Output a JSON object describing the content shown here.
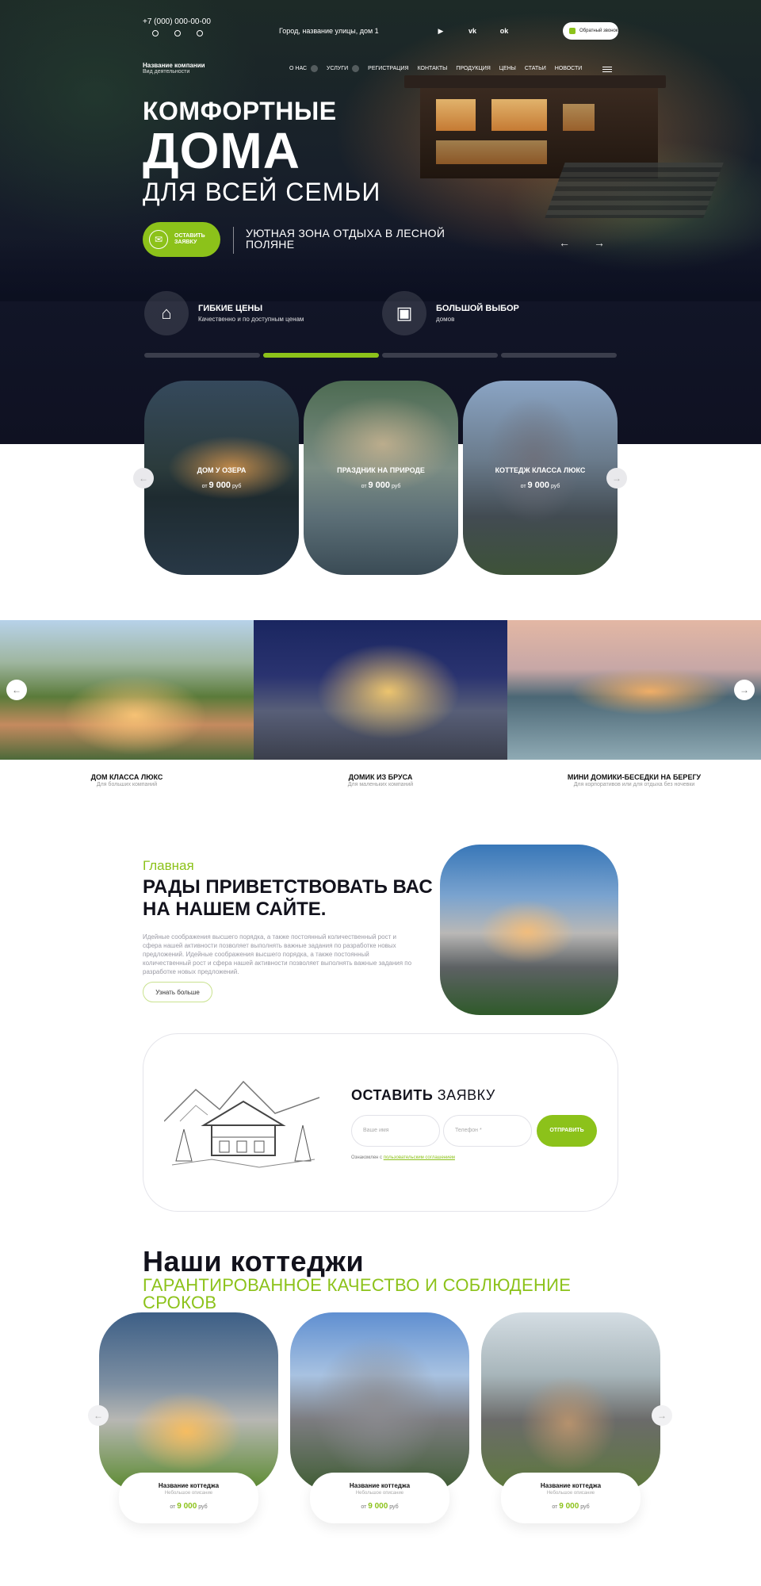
{
  "topbar": {
    "phone": "+7 (000) 000-00-00",
    "address": "Город, название улицы, дом 1",
    "social_icons": [
      "youtube-icon",
      "vk-icon",
      "ok-icon"
    ],
    "callback_label": "Обратный звонок"
  },
  "company": {
    "name": "Название компании",
    "activity": "Вид деятельности"
  },
  "nav": [
    "О НАС",
    "УСЛУГИ",
    "РЕГИСТРАЦИЯ",
    "КОНТАКТЫ",
    "ПРОДУКЦИЯ",
    "ЦЕНЫ",
    "СТАТЬИ",
    "НОВОСТИ"
  ],
  "hero": {
    "line1": "КОМФОРТНЫЕ",
    "line2": "ДОМА",
    "line3": "ДЛЯ ВСЕЙ СЕМЬИ",
    "cta_label": "ОСТАВИТЬ ЗАЯВКУ",
    "cta_text": "УЮТНАЯ ЗОНА ОТДЫХА В ЛЕСНОЙ ПОЛЯНЕ",
    "features": [
      {
        "title": "ГИБКИЕ ЦЕНЫ",
        "subtitle": "Качественно и по доступным ценам"
      },
      {
        "title": "БОЛЬШОЙ  ВЫБОР",
        "subtitle": "домов"
      }
    ],
    "active_slide": 2,
    "slides_total": 4
  },
  "offers": [
    {
      "title": "ДОМ У ОЗЕРА",
      "price_prefix": "от",
      "price": "9 000",
      "unit": "руб"
    },
    {
      "title": "ПРАЗДНИК НА ПРИРОДЕ",
      "price_prefix": "от",
      "price": "9 000",
      "unit": "руб"
    },
    {
      "title": "КОТТЕДЖ КЛАССА ЛЮКС",
      "price_prefix": "от",
      "price": "9 000",
      "unit": "руб"
    }
  ],
  "strip": [
    {
      "title": "ДОМ КЛАССА ЛЮКС",
      "desc": "Для больших компаний"
    },
    {
      "title": "ДОМИК ИЗ БРУСА",
      "desc": "Для маленьких компаний"
    },
    {
      "title": "МИНИ ДОМИКИ-БЕСЕДКИ НА БЕРЕГУ",
      "desc": "Для корпоративов или для отдыха без ночевки"
    }
  ],
  "welcome": {
    "kicker": "Главная",
    "heading": "РАДЫ ПРИВЕТСТВОВАТЬ ВАС НА НАШЕМ САЙТЕ.",
    "body": "Идейные соображения высшего порядка, а также постоянный количественный рост и сфера нашей активности позволяет выполнять важные задания по разработке новых предложений. Идейные соображения высшего порядка, а также постоянный количественный рост и сфера нашей активности позволяет выполнять важные задания по разработке новых предложений.",
    "button": "Узнать больше"
  },
  "form": {
    "heading_bold": "ОСТАВИТЬ",
    "heading_light": " ЗАЯВКУ",
    "name_placeholder": "Ваше имя",
    "phone_placeholder": "Телефон *",
    "submit": "ОТПРАВИТЬ",
    "agree_text": "Ознакомлен с",
    "agree_link": "пользовательским соглашением"
  },
  "cottages": {
    "heading": "Наши коттеджи",
    "subheading": "ГАРАНТИРОВАННОЕ КАЧЕСТВО И СОБЛЮДЕНИЕ СРОКОВ",
    "items": [
      {
        "title": "Название коттеджа",
        "desc": "Небольшое описание",
        "price_prefix": "от",
        "price": "9 000",
        "unit": "руб"
      },
      {
        "title": "Название коттеджа",
        "desc": "Небольшое описание",
        "price_prefix": "от",
        "price": "9 000",
        "unit": "руб"
      },
      {
        "title": "Название коттеджа",
        "desc": "Небольшое описание",
        "price_prefix": "от",
        "price": "9 000",
        "unit": "руб"
      }
    ]
  },
  "colors": {
    "accent": "#8cc21a",
    "dark": "#12121c",
    "hero_bg": "#121628"
  }
}
